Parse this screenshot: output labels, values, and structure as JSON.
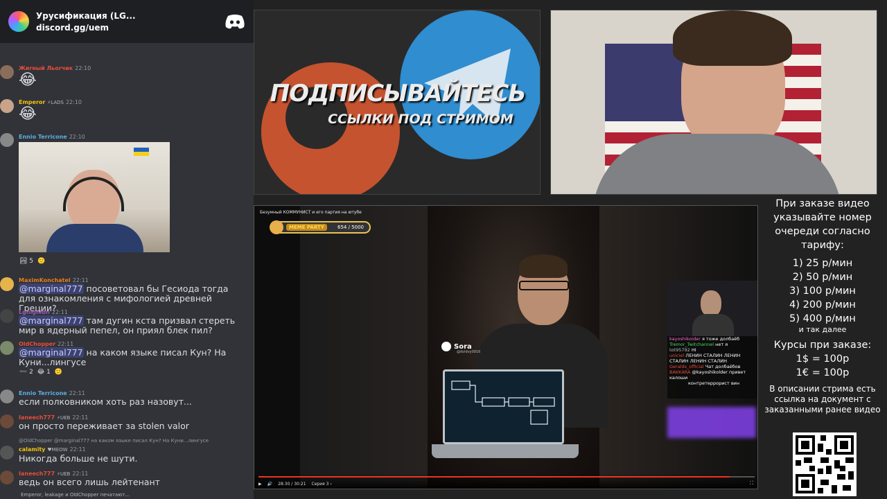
{
  "discord": {
    "server_name": "Урусификация (LG...",
    "invite": "discord.gg/uem",
    "messages": [
      {
        "user": "Жиrный Льоrчик",
        "user_color": "#e74c3c",
        "time": "22:10",
        "emoji": "😂"
      },
      {
        "user": "Emperor",
        "badge": "⚡LADS",
        "user_color": "#f1c40f",
        "time": "22:10",
        "emoji": "😂"
      },
      {
        "user": "Ennio Terricone",
        "user_color": "#5dade2",
        "time": "22:10",
        "reactions": [
          "🏞 5",
          "🙂"
        ]
      },
      {
        "user": "MaximKonchatel",
        "user_color": "#e67e22",
        "time": "22:11",
        "mention": "@marginal777",
        "text": " посоветовал бы Гесиода тогда для ознакомления с мифологией древней Греции?"
      },
      {
        "user": "Lgnignibn",
        "user_color": "#9b59b6",
        "time": "22:11",
        "mention": "@marginal777",
        "text": " там дугин кста призвал стереть мир в ядерный пепел, он приял блек пил?"
      },
      {
        "user": "OldChopper",
        "user_color": "#e74c3c",
        "time": "22:11",
        "mention": "@marginal777",
        "text": " на каком языке писал Кун? На Куни...лингусе",
        "reactions": [
          "➖ 2",
          "😂 1",
          "🙂"
        ]
      },
      {
        "user": "Ennio Terricone",
        "user_color": "#5dade2",
        "time": "22:11",
        "text": "если полковником хоть раз назовут..."
      },
      {
        "user": "Ianeech777",
        "badge": "⚡UEB",
        "user_color": "#e74c3c",
        "time": "22:11",
        "text": "он просто переживает за stolen valor"
      },
      {
        "reply": "@OldChopper @marginal777 на каком языке писал Кун? На Куни...лингусе",
        "user": "calamity",
        "badge": "♥MEOW",
        "user_color": "#f1c40f",
        "time": "22:11",
        "text": "Никогда больше не шути."
      },
      {
        "user": "Ianeech777",
        "badge": "⚡UEB",
        "user_color": "#e74c3c",
        "time": "22:11",
        "text": "ведь он всего лишь лейтенант"
      }
    ],
    "typing": "Emperor, leakage и OldChopper печатают..."
  },
  "banner": {
    "title": "ПОДПИСЫВАЙТЕСЬ",
    "subtitle": "ССЫЛКИ ПОД СТРИМОМ"
  },
  "player": {
    "title": "Безумный КОММУНИСТ и его партия на ютубе",
    "meme_label": "MEME PARTY",
    "meme_count": "654 / 5000",
    "sora_label": "Sora",
    "sora_handle": "@dvidvy0916",
    "progress": 0.95,
    "time": "28:30 / 30:21",
    "chapter": "Серия 3 ›",
    "twitch_chat": [
      {
        "user": "kayoshikoider",
        "color": "#ff6bd6",
        "text": " я тоже долбаёб"
      },
      {
        "user": "Tremor_Twitchannel",
        "color": "#4cd964",
        "text": " нет я"
      },
      {
        "user": "tot95792",
        "color": "#bbbbbb",
        "text": " HI"
      },
      {
        "user": "uniciel",
        "color": "#e74c3c",
        "text": " ЛЕНИН СТАЛИН ЛЕНИН СТАЛИН ЛЕНИН СТАЛИН"
      },
      {
        "user": "Geralds_official",
        "color": "#e74c3c",
        "text": " Чат долбаёбов"
      },
      {
        "user": "BAKKARA",
        "color": "#e74c3c",
        "text": " @kayoshikolder привет калоши"
      },
      {
        "user": "",
        "color": "#ffffff",
        "text": "контретеррорист вин"
      }
    ]
  },
  "info": {
    "intro": "При заказе видео указывайте номер очереди согласно тарифу:",
    "tariffs": [
      "1) 25 р/мин",
      "2) 50 р/мин",
      "3) 100 р/мин",
      "4) 200 р/мин",
      "5) 400 р/мин"
    ],
    "and_more": "и так далее",
    "courses_title": "Курсы при заказе:",
    "courses": [
      "1$ = 100р",
      "1€ = 100р"
    ],
    "description": "В описании стрима есть ссылка на документ с заказанными ранее видео"
  }
}
